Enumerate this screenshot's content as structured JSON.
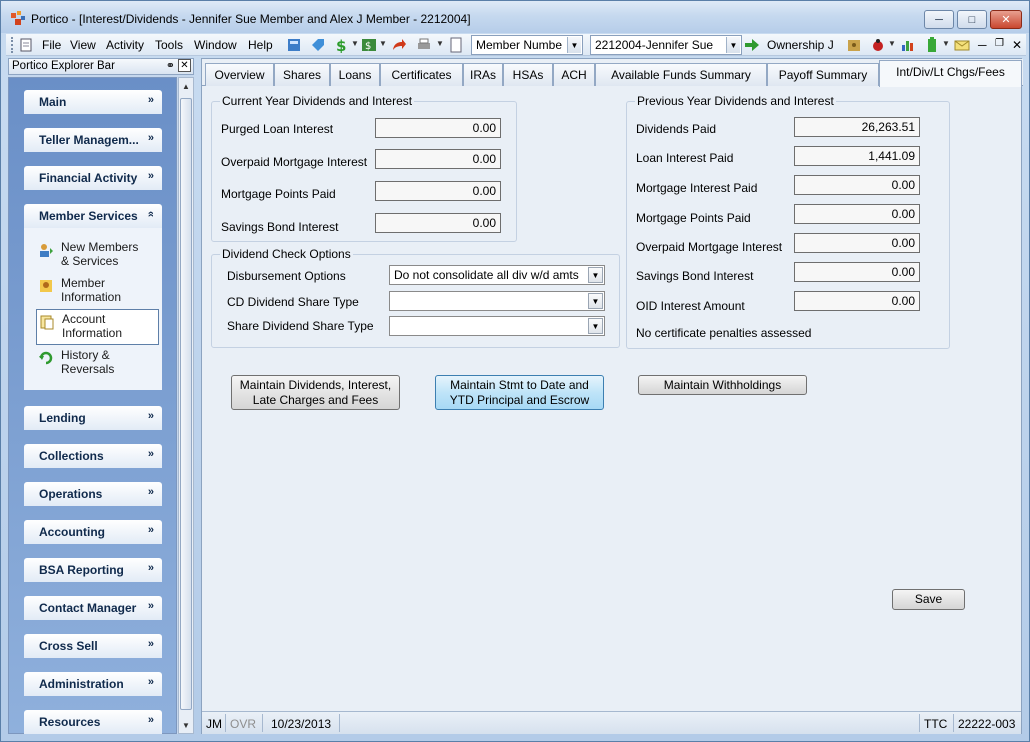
{
  "window": {
    "title": "Portico - [Interest/Dividends - Jennifer Sue Member and Alex J Member - 2212004]",
    "minimize_icon": "minimize-icon",
    "maximize_icon": "maximize-icon",
    "close_icon": "close-icon"
  },
  "menu": {
    "items": [
      "File",
      "View",
      "Activity",
      "Tools",
      "Window",
      "Help"
    ],
    "search_type": "Member Numbe",
    "member_selector": "2212004-Jennifer Sue",
    "ownership_label": "Ownership J"
  },
  "explorer": {
    "title": "Portico Explorer Bar",
    "groups": [
      {
        "label": "Main"
      },
      {
        "label": "Teller Managem..."
      },
      {
        "label": "Financial Activity"
      },
      {
        "label": "Member Services"
      },
      {
        "label": "Lending"
      },
      {
        "label": "Collections"
      },
      {
        "label": "Operations"
      },
      {
        "label": "Accounting"
      },
      {
        "label": "BSA Reporting"
      },
      {
        "label": "Contact Manager"
      },
      {
        "label": "Cross Sell"
      },
      {
        "label": "Administration"
      },
      {
        "label": "Resources"
      }
    ],
    "member_services_items": [
      {
        "label": "New Members\n& Services",
        "icon": "new-members-icon"
      },
      {
        "label": "Member\nInformation",
        "icon": "member-info-icon"
      },
      {
        "label": "Account\nInformation",
        "icon": "account-info-icon"
      },
      {
        "label": "History &\nReversals",
        "icon": "history-icon"
      }
    ]
  },
  "tabs": [
    {
      "label": "Overview"
    },
    {
      "label": "Shares"
    },
    {
      "label": "Loans"
    },
    {
      "label": "Certificates"
    },
    {
      "label": "IRAs"
    },
    {
      "label": "HSAs"
    },
    {
      "label": "ACH"
    },
    {
      "label": "Available Funds Summary"
    },
    {
      "label": "Payoff Summary"
    },
    {
      "label": "Int/Div/Lt Chgs/Fees"
    }
  ],
  "current_year": {
    "title": "Current Year Dividends and Interest",
    "rows": [
      {
        "label": "Purged Loan Interest",
        "value": "0.00"
      },
      {
        "label": "Overpaid Mortgage Interest",
        "value": "0.00"
      },
      {
        "label": "Mortgage Points Paid",
        "value": "0.00"
      },
      {
        "label": "Savings Bond Interest",
        "value": "0.00"
      }
    ]
  },
  "dividend_check": {
    "title": "Dividend Check Options",
    "disbursement_label": "Disbursement Options",
    "disbursement_value": "Do not consolidate all div w/d amts",
    "cd_label": "CD Dividend Share Type",
    "cd_value": "",
    "share_label": "Share Dividend Share Type",
    "share_value": ""
  },
  "previous_year": {
    "title": "Previous Year Dividends and Interest",
    "rows": [
      {
        "label": "Dividends Paid",
        "value": "26,263.51"
      },
      {
        "label": "Loan Interest Paid",
        "value": "1,441.09"
      },
      {
        "label": "Mortgage Interest Paid",
        "value": "0.00"
      },
      {
        "label": "Mortgage Points Paid",
        "value": "0.00"
      },
      {
        "label": "Overpaid Mortgage Interest",
        "value": "0.00"
      },
      {
        "label": "Savings Bond Interest",
        "value": "0.00"
      },
      {
        "label": "OID Interest Amount",
        "value": "0.00"
      }
    ],
    "note": "No certificate penalties assessed"
  },
  "buttons": {
    "maintain_dividends": "Maintain Dividends, Interest,\nLate Charges and Fees",
    "maintain_stmt": "Maintain Stmt to Date and\nYTD Principal and Escrow",
    "maintain_withholdings": "Maintain Withholdings",
    "save": "Save"
  },
  "status": {
    "user": "JM",
    "mode": "OVR",
    "date": "10/23/2013",
    "ttc_label": "TTC",
    "ttc_value": "22222-003"
  }
}
